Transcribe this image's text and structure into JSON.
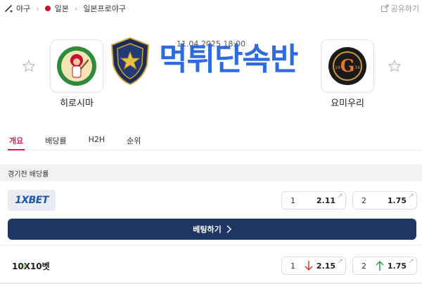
{
  "breadcrumb": {
    "items": [
      "야구",
      "일본",
      "일본프로야구"
    ]
  },
  "share": {
    "label": "공유하기"
  },
  "match": {
    "datetime": "11.04.2025 18:00",
    "home": {
      "name": "히로시마"
    },
    "away": {
      "name": "요미우리"
    }
  },
  "watermark": {
    "text": "먹튀단속반"
  },
  "tabs": [
    {
      "label": "개요",
      "active": true
    },
    {
      "label": "배당률",
      "active": false
    },
    {
      "label": "H2H",
      "active": false
    },
    {
      "label": "순위",
      "active": false
    }
  ],
  "odds_section": {
    "title": "경기전 배당률",
    "bet_button_label": "베팅하기",
    "books": [
      {
        "name": "1XBET",
        "odds": [
          {
            "label": "1",
            "value": "2.11"
          },
          {
            "label": "2",
            "value": "1.75"
          }
        ]
      },
      {
        "name": "10X10벳",
        "odds": [
          {
            "label": "1",
            "value": "2.15",
            "trend": "down"
          },
          {
            "label": "2",
            "value": "1.75",
            "trend": "up"
          }
        ]
      }
    ]
  },
  "colors": {
    "accent": "#e6135c",
    "button": "#1f3563",
    "watermark": "#2f6ae0",
    "trend_down": "#d9342b",
    "trend_up": "#21a14a"
  }
}
